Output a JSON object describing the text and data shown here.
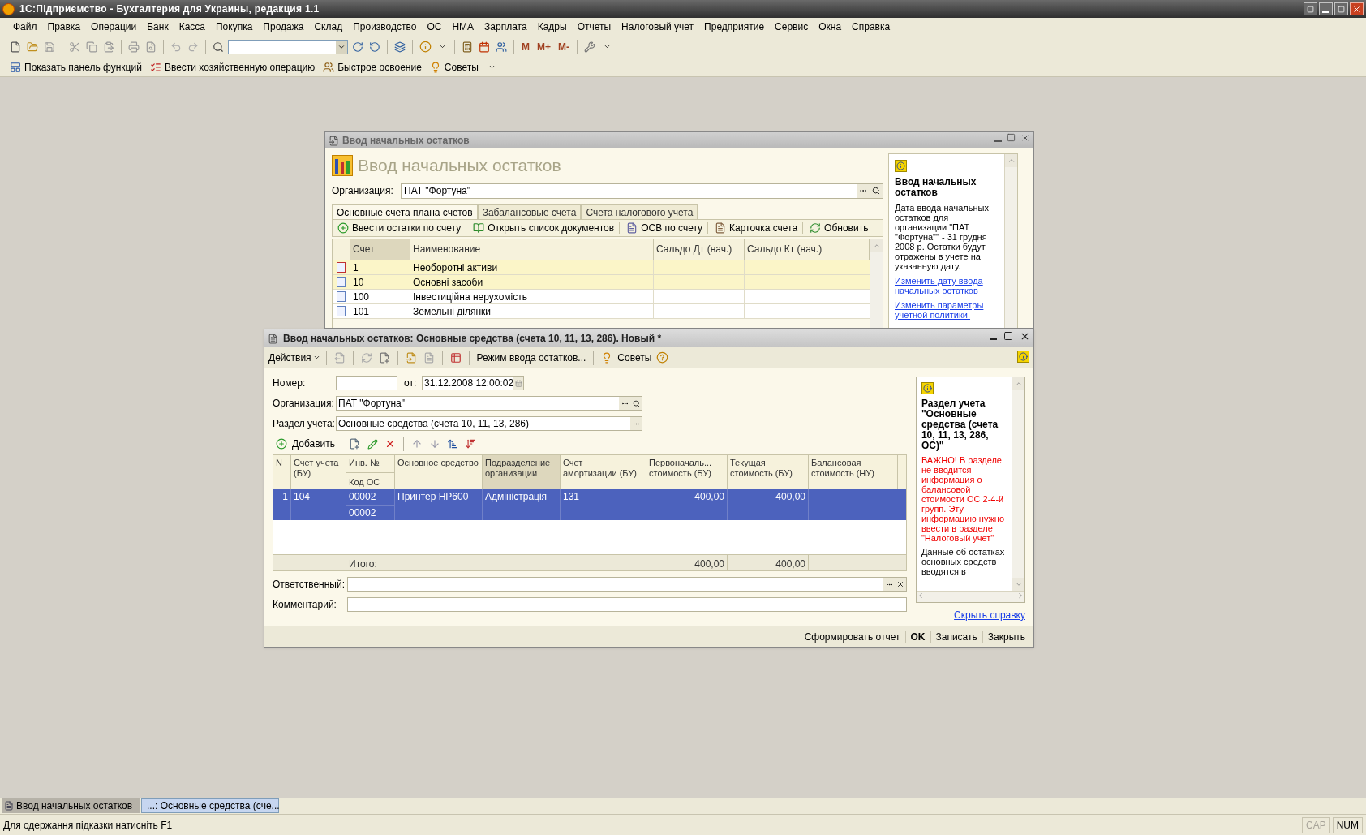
{
  "app_title": "1С:Підприємство - Бухгалтерия для Украины, редакция 1.1",
  "menu": [
    "Файл",
    "Правка",
    "Операции",
    "Банк",
    "Касса",
    "Покупка",
    "Продажа",
    "Склад",
    "Производство",
    "ОС",
    "НМА",
    "Зарплата",
    "Кадры",
    "Отчеты",
    "Налоговый учет",
    "Предприятие",
    "Сервис",
    "Окна",
    "Справка"
  ],
  "memory_buttons": [
    "M",
    "M+",
    "M-"
  ],
  "quick_toolbar": [
    "Показать панель функций",
    "Ввести хозяйственную операцию",
    "Быстрое освоение",
    "Советы"
  ],
  "bg_window": {
    "title": "Ввод начальных остатков",
    "heading": "Ввод начальных остатков",
    "org_label": "Организация:",
    "org_value": "ПАТ \"Фортуна\"",
    "tabs": [
      {
        "label": "Основные счета плана счетов",
        "selected": true
      },
      {
        "label": "Забалансовые счета",
        "selected": false
      },
      {
        "label": "Счета налогового учета",
        "selected": false
      }
    ],
    "actions": [
      "Ввести остатки по счету",
      "Открыть список документов",
      "ОСВ по счету",
      "Карточка счета",
      "Обновить"
    ],
    "columns": [
      {
        "label": "Счет",
        "selected": true
      },
      {
        "label": "Наименование",
        "selected": false
      },
      {
        "label": "Сальдо Дт (нач.)",
        "selected": false
      },
      {
        "label": "Сальдо Кт (нач.)",
        "selected": false
      }
    ],
    "rows": [
      {
        "account": "1",
        "name": "Необоротні активи",
        "highlighted": true,
        "kind": "group"
      },
      {
        "account": "10",
        "name": "Основні засоби",
        "highlighted": true,
        "kind": "item"
      },
      {
        "account": "100",
        "name": "Інвестиційна нерухомість",
        "highlighted": false,
        "kind": "item"
      },
      {
        "account": "101",
        "name": "Земельні ділянки",
        "highlighted": false,
        "kind": "item"
      }
    ],
    "help": {
      "title": "Ввод начальных остатков",
      "text": "Дата ввода начальных остатков для организации \"ПАТ \"Фортуна\"\" - 31 грудня 2008 р. Остатки будут отражены в учете на указанную дату.",
      "links": [
        "Изменить дату ввода начальных остатков",
        "Изменить параметры учетной политики."
      ]
    }
  },
  "doc_window": {
    "title": "Ввод начальных остатков: Основные средства (счета 10, 11, 13, 286). Новый *",
    "actions_menu": "Действия",
    "mode_button": "Режим ввода остатков...",
    "tips_button": "Советы",
    "number_label": "Номер:",
    "date_label": "от:",
    "date_value": "31.12.2008 12:00:02",
    "org_label": "Организация:",
    "org_value": "ПАТ \"Фортуна\"",
    "section_label": "Раздел учета:",
    "section_value": "Основные средства (счета 10, 11, 13, 286)",
    "add_button": "Добавить",
    "columns": [
      {
        "lines": [
          "N"
        ],
        "selected": false
      },
      {
        "lines": [
          "Счет учета",
          "(БУ)"
        ],
        "selected": false
      },
      {
        "lines": [
          "Инв. №"
        ],
        "sub": "Код ОС",
        "selected": false
      },
      {
        "lines": [
          "Основное средство"
        ],
        "selected": false
      },
      {
        "lines": [
          "Подразделение",
          "организации"
        ],
        "selected": true
      },
      {
        "lines": [
          "Счет",
          "амортизации (БУ)"
        ],
        "selected": false
      },
      {
        "lines": [
          "Первоначаль...",
          "стоимость (БУ)"
        ],
        "selected": false
      },
      {
        "lines": [
          "Текущая",
          "стоимость (БУ)"
        ],
        "selected": false
      },
      {
        "lines": [
          "Балансовая",
          "стоимость (НУ)"
        ],
        "selected": false
      }
    ],
    "rows": [
      {
        "n": "1",
        "account": "104",
        "inv_no": "00002",
        "os_code": "00002",
        "asset": "Принтер HP600",
        "department": "Адміністрація",
        "depr_account": "131",
        "initial_cost": "400,00",
        "current_cost": "400,00",
        "selected": true
      }
    ],
    "totals": {
      "label": "Итого:",
      "initial_cost": "400,00",
      "current_cost": "400,00"
    },
    "responsible_label": "Ответственный:",
    "comment_label": "Комментарий:",
    "help": {
      "title": "Раздел учета \"Основные средства (счета 10, 11, 13, 286, ОС)\"",
      "warning": "ВАЖНО! В разделе не вводится информация о балансовой стоимости ОС 2-4-й групп. Эту информацию нужно ввести в разделе \"Налоговый учет\"",
      "text": "Данные об остатках основных средств вводятся в",
      "hide_link": "Скрыть справку"
    },
    "buttons": [
      {
        "label": "Сформировать отчет",
        "default": false
      },
      {
        "label": "OK",
        "default": true
      },
      {
        "label": "Записать",
        "default": false
      },
      {
        "label": "Закрыть",
        "default": false
      }
    ]
  },
  "taskbar": [
    {
      "label": "Ввод начальных остатков",
      "selected": false
    },
    {
      "label": "...: Основные средства (сче...",
      "selected": true
    }
  ],
  "status": {
    "hint": "Для одержання підказки натисніть F1",
    "indicators": [
      {
        "label": "CAP",
        "on": false
      },
      {
        "label": "NUM",
        "on": true
      }
    ]
  }
}
